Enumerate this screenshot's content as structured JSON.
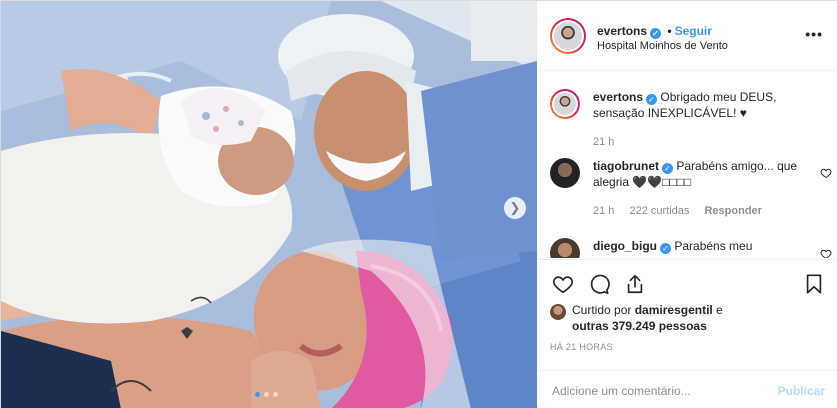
{
  "post": {
    "username": "evertons",
    "follow_label": "Seguir",
    "separator": "•",
    "location": "Hospital Moinhos de Vento",
    "more_icon": "more-options-icon",
    "carousel": {
      "next_icon": "chevron-right-icon",
      "slides": 3,
      "active_slide": 1
    }
  },
  "caption": {
    "username": "evertons",
    "text": "Obrigado meu DEUS, sensação INEXPLICÁVEL! ♥",
    "time": "21 h"
  },
  "comments": [
    {
      "username": "tiagobrunet",
      "text": "Parabéns amigo... que alegria 🖤🖤□□□□",
      "time": "21 h",
      "likes": "222 curtidas",
      "reply_label": "Responder"
    },
    {
      "username": "diego_bigu",
      "text": "Parabéns meu"
    }
  ],
  "actions": {
    "like_icon": "heart-icon",
    "comment_icon": "comment-icon",
    "share_icon": "share-icon",
    "save_icon": "bookmark-icon"
  },
  "likes": {
    "prefix": "Curtido por",
    "user": "damiresgentil",
    "connector": "e",
    "others": "outras 379.249 pessoas"
  },
  "timestamp": "HÁ 21 HORAS",
  "add_comment": {
    "placeholder": "Adicione um comentário...",
    "publish_label": "Publicar"
  },
  "colors": {
    "accent": "#3897f0",
    "publish_disabled": "#b2dffc",
    "border": "#dbdbdb",
    "muted": "#8e8e8e"
  }
}
